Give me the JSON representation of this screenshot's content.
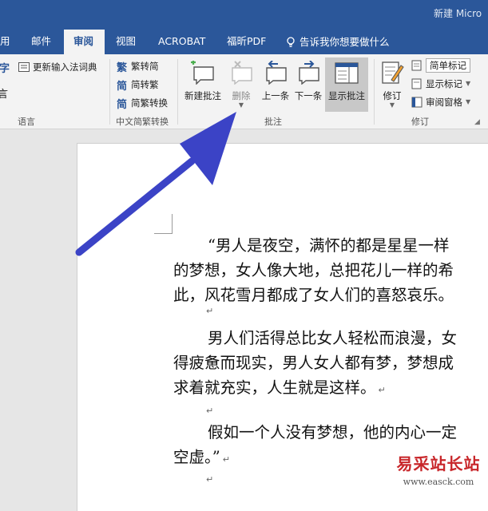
{
  "window": {
    "title": "新建 Micro"
  },
  "tabs": [
    {
      "label": "用"
    },
    {
      "label": "邮件"
    },
    {
      "label": "审阅",
      "active": true
    },
    {
      "label": "视图"
    },
    {
      "label": "ACROBAT"
    },
    {
      "label": "福昕PDF"
    }
  ],
  "tell_me": "告诉我你想要做什么",
  "ribbon": {
    "language": {
      "items": [
        {
          "icon": "字",
          "label": ""
        },
        {
          "icon": "言",
          "label": ""
        },
        {
          "icon": "update-ime-icon",
          "label": "更新输入法词典"
        }
      ],
      "label": "语言"
    },
    "chinese_conversion": {
      "items": [
        {
          "icon": "繁",
          "label": "繁转简"
        },
        {
          "icon": "简",
          "label": "简转繁"
        },
        {
          "icon": "简",
          "label": "简繁转换"
        }
      ],
      "label": "中文简繁转换"
    },
    "comments": {
      "buttons": [
        {
          "label": "新建批注",
          "icon": "new-comment-icon"
        },
        {
          "label": "删除",
          "icon": "delete-comment-icon",
          "disabled": true
        },
        {
          "label": "上一条",
          "icon": "previous-comment-icon"
        },
        {
          "label": "下一条",
          "icon": "next-comment-icon"
        },
        {
          "label": "显示批注",
          "icon": "show-comments-icon",
          "pressed": true
        }
      ],
      "label": "批注"
    },
    "tracking": {
      "track_changes_label": "修订",
      "markup_select": "简单标记",
      "show_markup": "显示标记",
      "review_pane": "审阅窗格",
      "label": "修订"
    }
  },
  "document": {
    "paragraphs": [
      {
        "lines": [
          "“男人是夜空，满怀的都是星星一样",
          "的梦想，女人像大地，总把花儿一样的希",
          "此，风花雪月都成了女人们的喜怒哀乐。"
        ],
        "indent_first": true
      },
      {
        "lines": [
          "男人们活得总比女人轻松而浪漫，女",
          "得疲惫而现实，男人女人都有梦，梦想成",
          "求着就充实，人生就是这样。"
        ],
        "indent_first": true,
        "end_mark": "↵"
      },
      {
        "lines": [
          "假如一个人没有梦想，他的内心一定",
          "空虚。”"
        ],
        "indent_first": true,
        "end_mark": "↵"
      }
    ],
    "empty_para_mark": "↵"
  },
  "watermark": {
    "text": "易采站长站",
    "url": "www.easck.com"
  },
  "colors": {
    "accent": "#2b579a",
    "arrow": "#3b43c6",
    "watermark": "#c8262a"
  }
}
